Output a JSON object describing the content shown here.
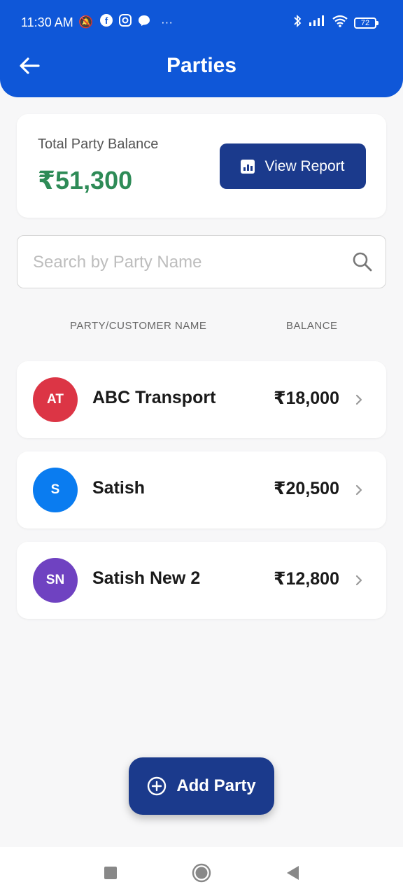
{
  "status_bar": {
    "time": "11:30 AM",
    "battery": "72",
    "icons": [
      "mute-icon",
      "facebook-icon",
      "instagram-icon",
      "messenger-icon",
      "more-icon",
      "bluetooth-icon",
      "signal-icon",
      "wifi-icon",
      "battery-icon"
    ]
  },
  "header": {
    "title": "Parties",
    "back_icon": "arrow-left-icon"
  },
  "summary": {
    "label": "Total Party Balance",
    "value": "₹51,300",
    "report_button": "View Report",
    "report_icon": "report-icon"
  },
  "search": {
    "placeholder": "Search by Party Name",
    "value": "",
    "icon": "search-icon"
  },
  "table": {
    "col_name": "PARTY/CUSTOMER NAME",
    "col_balance": "BALANCE"
  },
  "parties": [
    {
      "initials": "AT",
      "name": "ABC Transport",
      "balance": "₹18,000",
      "color": "#dc3545"
    },
    {
      "initials": "S",
      "name": "Satish",
      "balance": "₹20,500",
      "color": "#0a7cf0"
    },
    {
      "initials": "SN",
      "name": "Satish New 2",
      "balance": "₹12,800",
      "color": "#6f42c1"
    }
  ],
  "fab": {
    "label": "Add Party",
    "icon": "plus-circle-icon"
  },
  "colors": {
    "header": "#0f57d8",
    "primary_button": "#1b3a8c",
    "balance_green": "#2e8b57",
    "background": "#f7f7f8"
  }
}
